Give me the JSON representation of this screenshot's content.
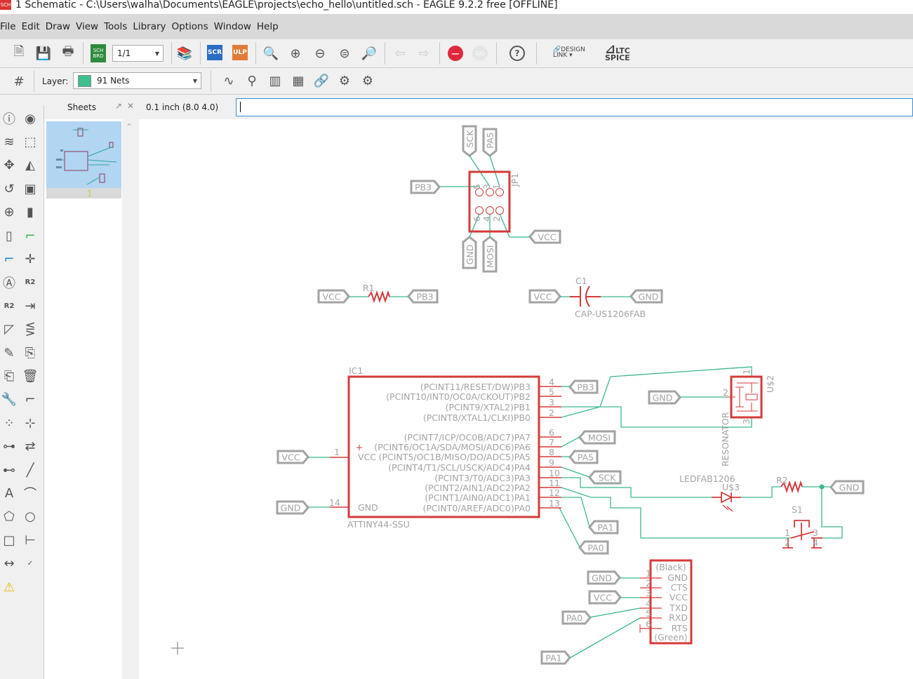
{
  "window": {
    "title": "1 Schematic - C:\\Users\\walha\\Documents\\EAGLE\\projects\\echo_hello\\untitled.sch - EAGLE 9.2.2 free [OFFLINE]",
    "app_icon": "SCH"
  },
  "menu": [
    "File",
    "Edit",
    "Draw",
    "View",
    "Tools",
    "Library",
    "Options",
    "Window",
    "Help"
  ],
  "toolbar1": {
    "sheet_select": "1/1",
    "sch_brd": "SCH BRD",
    "scr": "SCR",
    "ulp": "ULP",
    "go": "GO",
    "design_link": "DESIGN LINK",
    "ltspice": "LTC SPICE",
    "icons": [
      "new-file-icon",
      "save-icon",
      "print-icon",
      "sch-brd-switch-icon",
      "library-icon",
      "script-icon",
      "ulp-icon",
      "zoom-fit-icon",
      "zoom-in-icon",
      "zoom-out-icon",
      "zoom-redraw-icon",
      "zoom-select-icon",
      "undo-icon",
      "redo-icon",
      "stop-icon",
      "go-icon",
      "help-icon",
      "design-link-icon",
      "ltspice-icon"
    ],
    "colors": {
      "scr": "#2b6cc4",
      "ulp": "#e07b39",
      "stop": "#e0283c"
    }
  },
  "toolbar2": {
    "layer_label": "Layer:",
    "layer_value": "91 Nets",
    "layer_color": "#3dbf8e",
    "icons": [
      "grid-icon",
      "simulate-icon",
      "probe-icon",
      "multimeter-icon",
      "multimeter2-icon",
      "link-add-icon",
      "settings-icon",
      "settings2-icon"
    ]
  },
  "panel": {
    "sheets_title": "Sheets",
    "sheet_number": "1",
    "grid_readout": "0.1 inch (8.0 4.0)",
    "command_value": ""
  },
  "left_tools": [
    "info",
    "show",
    "layers",
    "select",
    "move",
    "mirror",
    "rotate",
    "add-part",
    "add-gate",
    "replace",
    "invoke",
    "net",
    "bus",
    "junction",
    "label",
    "name",
    "value",
    "pinswap",
    "split",
    "smash",
    "tag",
    "copy",
    "paste",
    "delete",
    "change",
    "miter",
    "optimize",
    "split2",
    "slice",
    "gateswap",
    "attribute",
    "line",
    "text",
    "arc",
    "polygon",
    "circle",
    "rectangle",
    "dimension",
    "measure",
    "erc",
    "errors"
  ],
  "schematic": {
    "net_labels": [
      {
        "text": "SCK"
      },
      {
        "text": "PA5"
      },
      {
        "text": "PB3"
      },
      {
        "text": "VCC"
      },
      {
        "text": "GND"
      },
      {
        "text": "MOSI"
      },
      {
        "text": "VCC"
      },
      {
        "text": "PB3"
      },
      {
        "text": "VCC"
      },
      {
        "text": "GND"
      },
      {
        "text": "PB3"
      },
      {
        "text": "GND"
      },
      {
        "text": "MOSI"
      },
      {
        "text": "PA5"
      },
      {
        "text": "SCK"
      },
      {
        "text": "GND"
      },
      {
        "text": "PA1"
      },
      {
        "text": "PA0"
      },
      {
        "text": "VCC"
      },
      {
        "text": "GND"
      },
      {
        "text": "GND"
      },
      {
        "text": "VCC"
      },
      {
        "text": "PA0"
      },
      {
        "text": "PA1"
      }
    ],
    "jp1": {
      "name": "JP1",
      "pins_top": [
        "5",
        "3",
        "1"
      ],
      "pins_bottom": [
        "6",
        "4",
        "2"
      ]
    },
    "r1": {
      "name": "R1"
    },
    "c1": {
      "name": "C1",
      "value": "CAP-US1206FAB"
    },
    "ic1": {
      "name": "IC1",
      "value": "ATTINY44-SSU",
      "right_pins": [
        {
          "num": "4",
          "label": "(PCINT11/RESET/DW)PB3"
        },
        {
          "num": "5",
          "label": "(PCINT10/INT0/OC0A/CKOUT)PB2"
        },
        {
          "num": "3",
          "label": "(PCINT9/XTAL2)PB1"
        },
        {
          "num": "2",
          "label": "(PCINT8/XTAL1/CLKI)PB0"
        },
        {
          "num": "6",
          "label": "(PCINT7/ICP/OC0B/ADC7)PA7"
        },
        {
          "num": "7",
          "label": "(PCINT6/OC1A/SDA/MOSI/ADC6)PA6"
        },
        {
          "num": "8",
          "label": "(PCINT5/OC1B/MISO/DO/ADC5)PA5"
        },
        {
          "num": "9",
          "label": "(PCINT4/T1/SCL/USCK/ADC4)PA4"
        },
        {
          "num": "10",
          "label": "(PCINT3/T0/ADC3)PA3"
        },
        {
          "num": "11",
          "label": "(PCINT2/AIN1/ADC2)PA2"
        },
        {
          "num": "12",
          "label": "(PCINT1/AIN0/ADC1)PA1"
        },
        {
          "num": "13",
          "label": "(PCINT0/AREF/ADC0)PA0"
        }
      ],
      "left_pins": [
        {
          "num": "1",
          "label": "VCC"
        },
        {
          "num": "14",
          "label": "GND"
        }
      ]
    },
    "u2": {
      "name": "U$2",
      "value": "RESONATOR",
      "pins": [
        "1",
        "2",
        "3"
      ]
    },
    "led": {
      "name": "U$3",
      "value": "LEDFAB1206"
    },
    "r2": {
      "name": "R2"
    },
    "s1": {
      "name": "S1",
      "pins": [
        "1",
        "2",
        "3",
        "4"
      ]
    },
    "ftdi": {
      "top": "(Black)",
      "bottom": "(Green)",
      "pins": [
        {
          "num": "1",
          "label": "GND"
        },
        {
          "num": "2",
          "label": "CTS"
        },
        {
          "num": "3",
          "label": "VCC"
        },
        {
          "num": "4",
          "label": "TXD"
        },
        {
          "num": "5",
          "label": "RXD"
        },
        {
          "num": "6",
          "label": "RTS"
        }
      ]
    },
    "colors": {
      "wire": "#3cb88e",
      "symbol": "#d63a3a",
      "text": "#a3a3a3"
    }
  }
}
